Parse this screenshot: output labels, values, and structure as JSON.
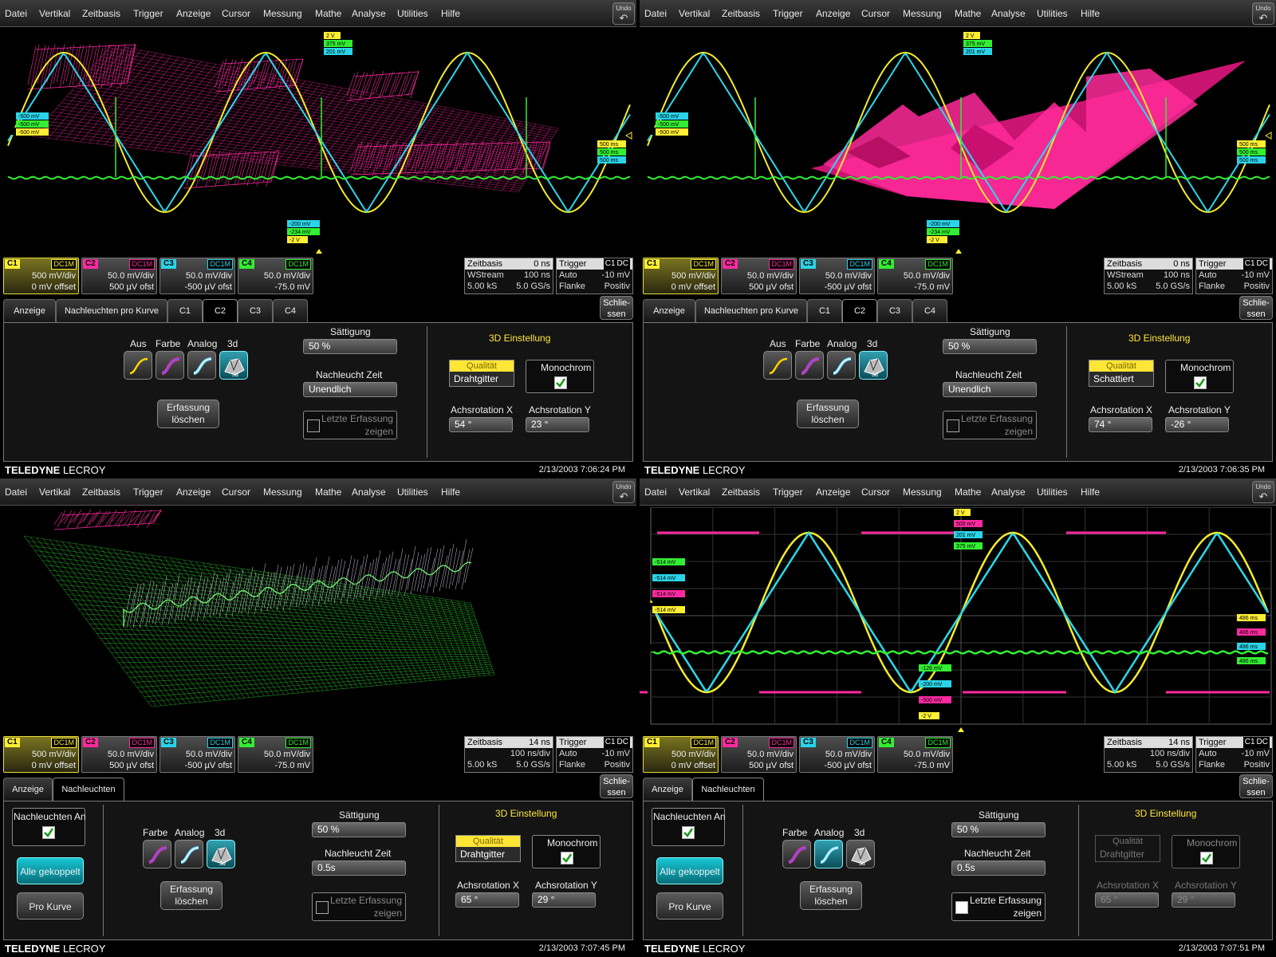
{
  "menu": [
    "Datei",
    "Vertikal",
    "Zeitbasis",
    "Trigger",
    "Anzeige",
    "Cursor",
    "Messung",
    "Mathe",
    "Analyse",
    "Utilities",
    "Hilfe"
  ],
  "undo_label": "Undo",
  "brand": {
    "bold": "TELEDYNE",
    "rest": " LECROY"
  },
  "channels": [
    {
      "name": "C1",
      "coupling": "DC1M",
      "line1": "500 mV/div",
      "line2": "0 mV offset",
      "color": "#ffee33"
    },
    {
      "name": "C2",
      "coupling": "DC1M",
      "line1": "50.0 mV/div",
      "line2": "500 µV ofst",
      "color": "#ff2aa0"
    },
    {
      "name": "C3",
      "coupling": "DC1M",
      "line1": "50.0 mV/div",
      "line2": "-500 µV ofst",
      "color": "#2ad4e8"
    },
    {
      "name": "C4",
      "coupling": "DC1M",
      "line1": "50.0 mV/div",
      "line2": "-75.0 mV",
      "color": "#33ee33"
    }
  ],
  "trigger": {
    "title": "Trigger",
    "ch": "C1",
    "coupling": "DC",
    "row1_l": "Auto",
    "row1_r": "-10 mV",
    "row2_l": "Flanke",
    "row2_r": "Positiv"
  },
  "close_label": {
    "l1": "Schlie-",
    "l2": "ssen"
  },
  "panels": [
    {
      "timebase": {
        "title": "Zeitbasis",
        "delay": "0 ns",
        "row1_l": "WStream",
        "row1_r": "100 ns",
        "row2_l": "5.00 kS",
        "row2_r": "5.0 GS/s"
      },
      "tabs": [
        "Anzeige",
        "Nachleuchten pro Kurve",
        "C1",
        "C2",
        "C3",
        "C4"
      ],
      "active_tab": "C2",
      "modes": [
        "Aus",
        "Farbe",
        "Analog",
        "3d"
      ],
      "mode_sub": "3d",
      "saturation_label": "Sättigung",
      "saturation": "50 %",
      "persist_label": "Nachleucht Zeit",
      "persist": "Unendlich",
      "clear_l1": "Erfassung",
      "clear_l2": "löschen",
      "last_l1": "Letzte Erfassung",
      "last_l2": "zeigen",
      "d3_title": "3D Einstellung",
      "quality_label": "Qualität",
      "quality": "Drahtgitter",
      "mono_label": "Monochrom",
      "rotx_label": "Achsrotation X",
      "rotx": "54 °",
      "roty_label": "Achsrotation Y",
      "roty": "23 °",
      "date": "2/13/2003 7:06:24 PM",
      "markers_top": [
        "2 V",
        "375 mV",
        "201 mV"
      ],
      "markers_left": [
        "-500 mV",
        "-500 mV",
        "-500 mV"
      ],
      "markers_right": [
        "500 ms",
        "500 ms",
        "500 ms"
      ],
      "markers_bottom": [
        "-200 mV",
        "-234 mV",
        "-2 V"
      ]
    },
    {
      "timebase": {
        "title": "Zeitbasis",
        "delay": "0 ns",
        "row1_l": "WStream",
        "row1_r": "100 ns",
        "row2_l": "5.00 kS",
        "row2_r": "5.0 GS/s"
      },
      "tabs": [
        "Anzeige",
        "Nachleuchten pro Kurve",
        "C1",
        "C2",
        "C3",
        "C4"
      ],
      "active_tab": "C2",
      "modes": [
        "Aus",
        "Farbe",
        "Analog",
        "3d"
      ],
      "mode_sub": "3d",
      "saturation_label": "Sättigung",
      "saturation": "50 %",
      "persist_label": "Nachleucht Zeit",
      "persist": "Unendlich",
      "clear_l1": "Erfassung",
      "clear_l2": "löschen",
      "last_l1": "Letzte Erfassung",
      "last_l2": "zeigen",
      "d3_title": "3D Einstellung",
      "quality_label": "Qualität",
      "quality": "Schattiert",
      "mono_label": "Monochrom",
      "rotx_label": "Achsrotation X",
      "rotx": "74 °",
      "roty_label": "Achsrotation Y",
      "roty": "-26 °",
      "date": "2/13/2003 7:06:35 PM",
      "markers_top": [
        "2 V",
        "375 mV",
        "201 mV"
      ],
      "markers_left": [
        "-500 mV",
        "-500 mV",
        "-500 mV"
      ],
      "markers_right": [
        "500 ms",
        "500 ms",
        "500 ms"
      ],
      "markers_bottom": [
        "-200 mV",
        "-234 mV",
        "-2 V"
      ]
    },
    {
      "timebase": {
        "title": "Zeitbasis",
        "delay": "14 ns",
        "row1_l": "",
        "row1_r": "100 ns/div",
        "row2_l": "5.00 kS",
        "row2_r": "5.0 GS/s"
      },
      "tabs": [
        "Anzeige",
        "Nachleuchten"
      ],
      "active_tab": "Nachleuchten",
      "all_label": "Nachleuchten An",
      "coupled": "Alle gekoppelt",
      "per_curve": "Pro Kurve",
      "modes": [
        "Farbe",
        "Analog",
        "3d"
      ],
      "mode_sub": "3d",
      "saturation_label": "Sättigung",
      "saturation": "50 %",
      "persist_label": "Nachleucht Zeit",
      "persist": "0.5s",
      "clear_l1": "Erfassung",
      "clear_l2": "löschen",
      "last_l1": "Letzte Erfassung",
      "last_l2": "zeigen",
      "d3_title": "3D Einstellung",
      "quality_label": "Qualität",
      "quality": "Drahtgitter",
      "mono_label": "Monochrom",
      "rotx_label": "Achsrotation X",
      "rotx": "65 °",
      "roty_label": "Achsrotation Y",
      "roty": "29 °",
      "date": "2/13/2003 7:07:45 PM"
    },
    {
      "timebase": {
        "title": "Zeitbasis",
        "delay": "14 ns",
        "row1_l": "",
        "row1_r": "100 ns/div",
        "row2_l": "5.00 kS",
        "row2_r": "5.0 GS/s"
      },
      "tabs": [
        "Anzeige",
        "Nachleuchten"
      ],
      "active_tab": "Nachleuchten",
      "all_label": "Nachleuchten An",
      "coupled": "Alle gekoppelt",
      "per_curve": "Pro Kurve",
      "modes": [
        "Farbe",
        "Analog",
        "3d"
      ],
      "mode_sub": "3d",
      "saturation_label": "Sättigung",
      "saturation": "50 %",
      "persist_label": "Nachleucht Zeit",
      "persist": "0.5s",
      "clear_l1": "Erfassung",
      "clear_l2": "löschen",
      "last_l1": "Letzte Erfassung",
      "last_l2": "zeigen",
      "d3_title": "3D Einstellung",
      "quality_label": "Qualität",
      "quality": "Drahtgitter",
      "mono_label": "Monochrom",
      "rotx_label": "Achsrotation X",
      "rotx": "65 °",
      "roty_label": "Achsrotation Y",
      "roty": "29 °",
      "date": "2/13/2003 7:07:51 PM",
      "markers_top": [
        "2 V",
        "500 mV",
        "201 mV",
        "375 mV"
      ],
      "markers_left": [
        "-514 mV",
        "-514 mV",
        "-514 mV",
        "-514 mV"
      ],
      "markers_right": [
        "486 ms",
        "486 ms",
        "486 ms",
        "486 ms"
      ],
      "markers_bottom": [
        "-126 mV",
        "-200 mV",
        "-500 mV",
        "-2 V"
      ]
    }
  ]
}
